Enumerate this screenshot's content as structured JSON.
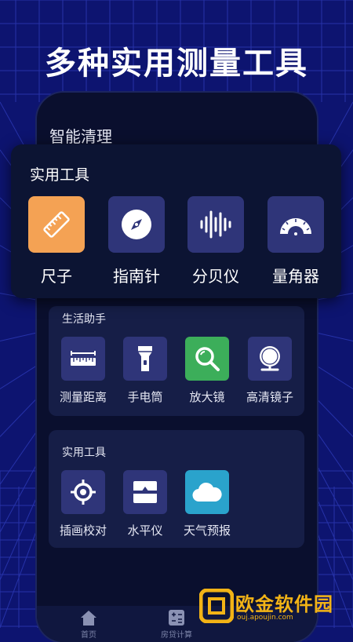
{
  "headline": "多种实用测量工具",
  "phone_title": "智能清理",
  "overlay": {
    "title": "实用工具",
    "items": [
      {
        "label": "尺子",
        "icon": "ruler-icon",
        "color": "#f4a254"
      },
      {
        "label": "指南针",
        "icon": "compass-icon",
        "color": "#2f3579"
      },
      {
        "label": "分贝仪",
        "icon": "sound-wave-icon",
        "color": "#2f3579"
      },
      {
        "label": "量角器",
        "icon": "protractor-icon",
        "color": "#2f3579"
      }
    ]
  },
  "life_card": {
    "title": "生活助手",
    "items": [
      {
        "label": "测量距离",
        "icon": "distance-ruler-icon",
        "color": "#2f3579"
      },
      {
        "label": "手电筒",
        "icon": "flashlight-icon",
        "color": "#2f3579"
      },
      {
        "label": "放大镜",
        "icon": "magnifier-icon",
        "color": "#3cae5a"
      },
      {
        "label": "高清镜子",
        "icon": "mirror-icon",
        "color": "#2f3579"
      }
    ]
  },
  "tools_card": {
    "title": "实用工具",
    "items": [
      {
        "label": "插画校对",
        "icon": "crosshair-icon",
        "color": "#2f3579"
      },
      {
        "label": "水平仪",
        "icon": "level-icon",
        "color": "#2f3579"
      },
      {
        "label": "天气预报",
        "icon": "cloud-icon",
        "color": "#2aa3cc"
      }
    ]
  },
  "nav": [
    {
      "label": "首页",
      "icon": "home-icon"
    },
    {
      "label": "房贷计算",
      "icon": "calculator-icon"
    }
  ],
  "watermark": {
    "text": "欧金软件园",
    "url": "ouj.apoujin.com"
  }
}
